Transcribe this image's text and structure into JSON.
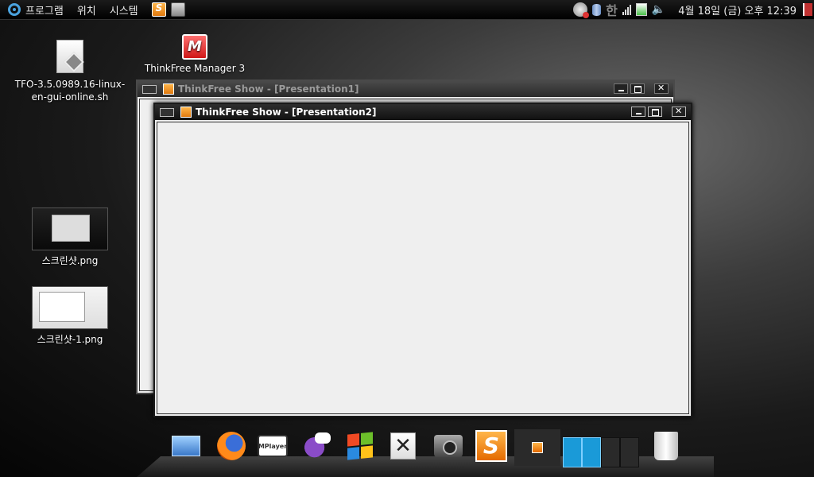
{
  "top_panel": {
    "menus": [
      "프로그램",
      "위치",
      "시스템"
    ],
    "clock": "4월 18일 (금) 오후 12:39",
    "ime_indicator": "한"
  },
  "desktop_icons": [
    {
      "label": "TFO-3.5.0989.16-linux-en-gui-online.sh",
      "icon": "script-file-icon"
    },
    {
      "label": "ThinkFree Manager 3",
      "icon": "thinkfree-manager-icon",
      "glyph": "M"
    },
    {
      "label": "스크린샷.png",
      "icon": "screenshot-thumbnail"
    },
    {
      "label": "스크린샷-1.png",
      "icon": "screenshot-thumbnail"
    }
  ],
  "windows": {
    "back": {
      "title": "ThinkFree Show - [Presentation1]"
    },
    "front": {
      "title": "ThinkFree Show - [Presentation2]"
    }
  },
  "dock": {
    "mplayer_label": "MPlayer",
    "show_glyph": "S",
    "items": [
      "mail-icon",
      "firefox-icon",
      "mplayer-icon",
      "pidgin-icon",
      "windows-icon",
      "x-editor-icon",
      "camera-icon",
      "thinkfree-show-icon",
      "thinkfree-show-minimized",
      "workspace-pager",
      "trash-icon"
    ]
  },
  "colors": {
    "accent": "#4aa3df",
    "show_orange": "#e07a10",
    "manager_red": "#d01818"
  }
}
